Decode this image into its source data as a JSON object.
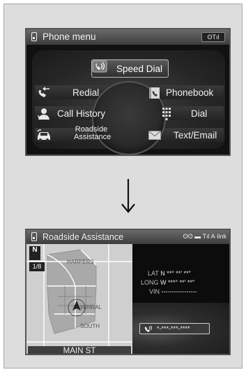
{
  "phone_menu": {
    "title": "Phone menu",
    "status": "ʘTıl",
    "items": {
      "speed_dial": "Speed Dial",
      "redial": "Redial",
      "phonebook": "Phonebook",
      "call_history": "Call History",
      "dial": "Dial",
      "roadside_line1": "Roadside",
      "roadside_line2": "Assistance",
      "text_email": "Text/Email"
    }
  },
  "transition_arrow": "↓",
  "roadside_screen": {
    "title": "Roadside Assistance",
    "status": "ʘʘ ▬ Tıl A·link",
    "map": {
      "compass": "N",
      "scale": "1/8",
      "streets": [
        "HARPERS",
        "WINRAL",
        "SOUTH"
      ],
      "current_street": "MAIN ST"
    },
    "location": {
      "lat_label": "LAT",
      "lat_value": "N **° **′ **″",
      "long_label": "LONG",
      "long_value": "W ***° **′ **″",
      "vin_label": "VIN",
      "vin_value": "-----------------"
    },
    "phone_number": "*-***-***-****"
  },
  "colors": {
    "screen_bg": "#111111",
    "frame_bg": "#dddddd",
    "text": "#f0f0f0"
  }
}
